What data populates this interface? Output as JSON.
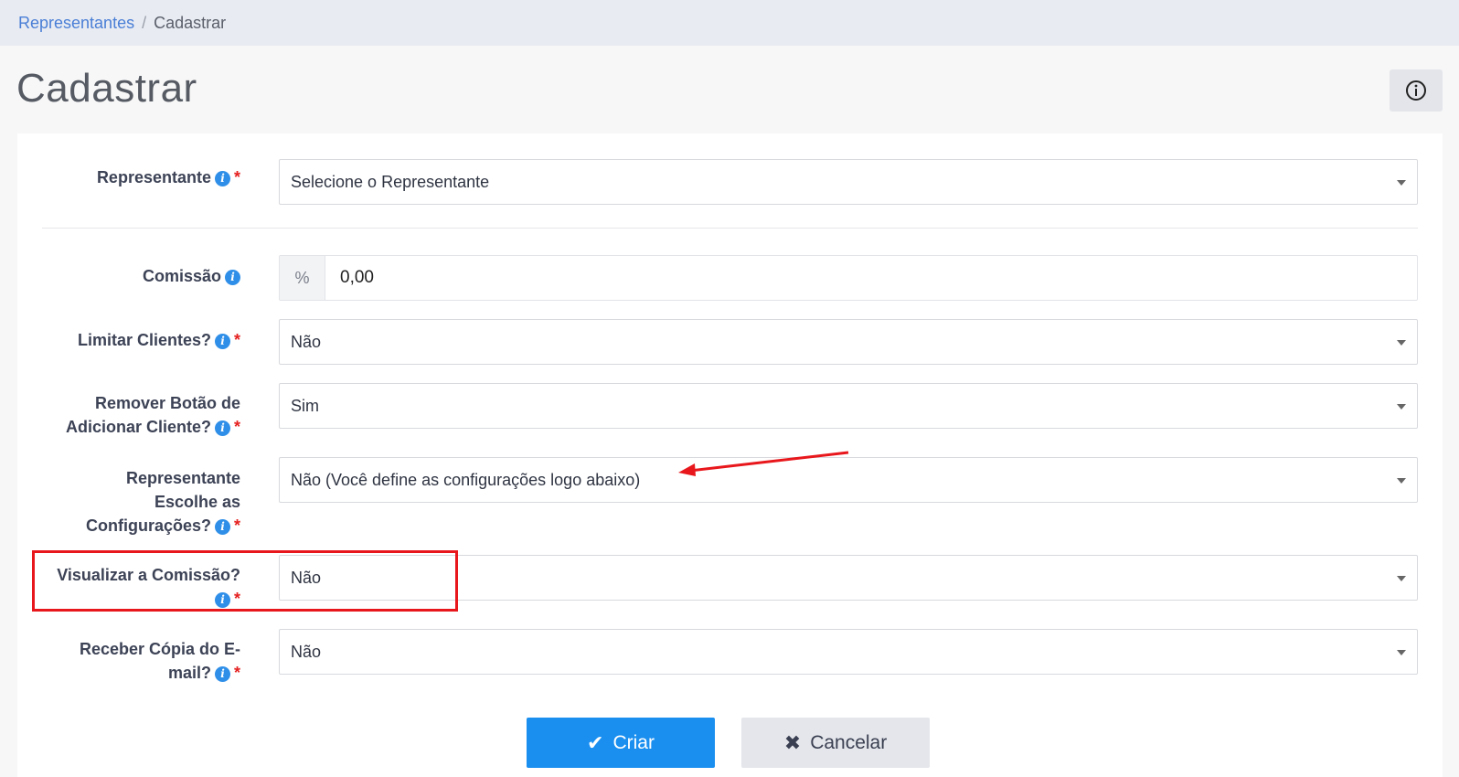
{
  "breadcrumb": {
    "link": "Representantes",
    "separator": "/",
    "current": "Cadastrar"
  },
  "page": {
    "title": "Cadastrar"
  },
  "form": {
    "representante": {
      "label": "Representante",
      "value": "Selecione o Representante"
    },
    "comissao": {
      "label": "Comissão",
      "addon": "%",
      "value": "0,00"
    },
    "limitar_clientes": {
      "label": "Limitar Clientes?",
      "value": "Não"
    },
    "remover_botao": {
      "label_line1": "Remover Botão de",
      "label_line2": "Adicionar Cliente?",
      "value": "Sim"
    },
    "escolhe_config": {
      "label_line1": "Representante",
      "label_line2": "Escolhe as",
      "label_line3": "Configurações?",
      "value": "Não (Você define as configurações logo abaixo)"
    },
    "visualizar_comissao": {
      "label": "Visualizar a Comissão?",
      "value": "Não"
    },
    "receber_copia": {
      "label_line1": "Receber Cópia do E-",
      "label_line2": "mail?",
      "value": "Não"
    },
    "required_mark": "*",
    "info_glyph": "i"
  },
  "buttons": {
    "create": "Criar",
    "cancel": "Cancelar"
  },
  "icons": {
    "help": "info-circle-icon",
    "check": "check-icon",
    "times": "times-icon"
  },
  "colors": {
    "accent": "#1a8ff0",
    "annotation": "#e8171c",
    "required": "#e52020"
  }
}
